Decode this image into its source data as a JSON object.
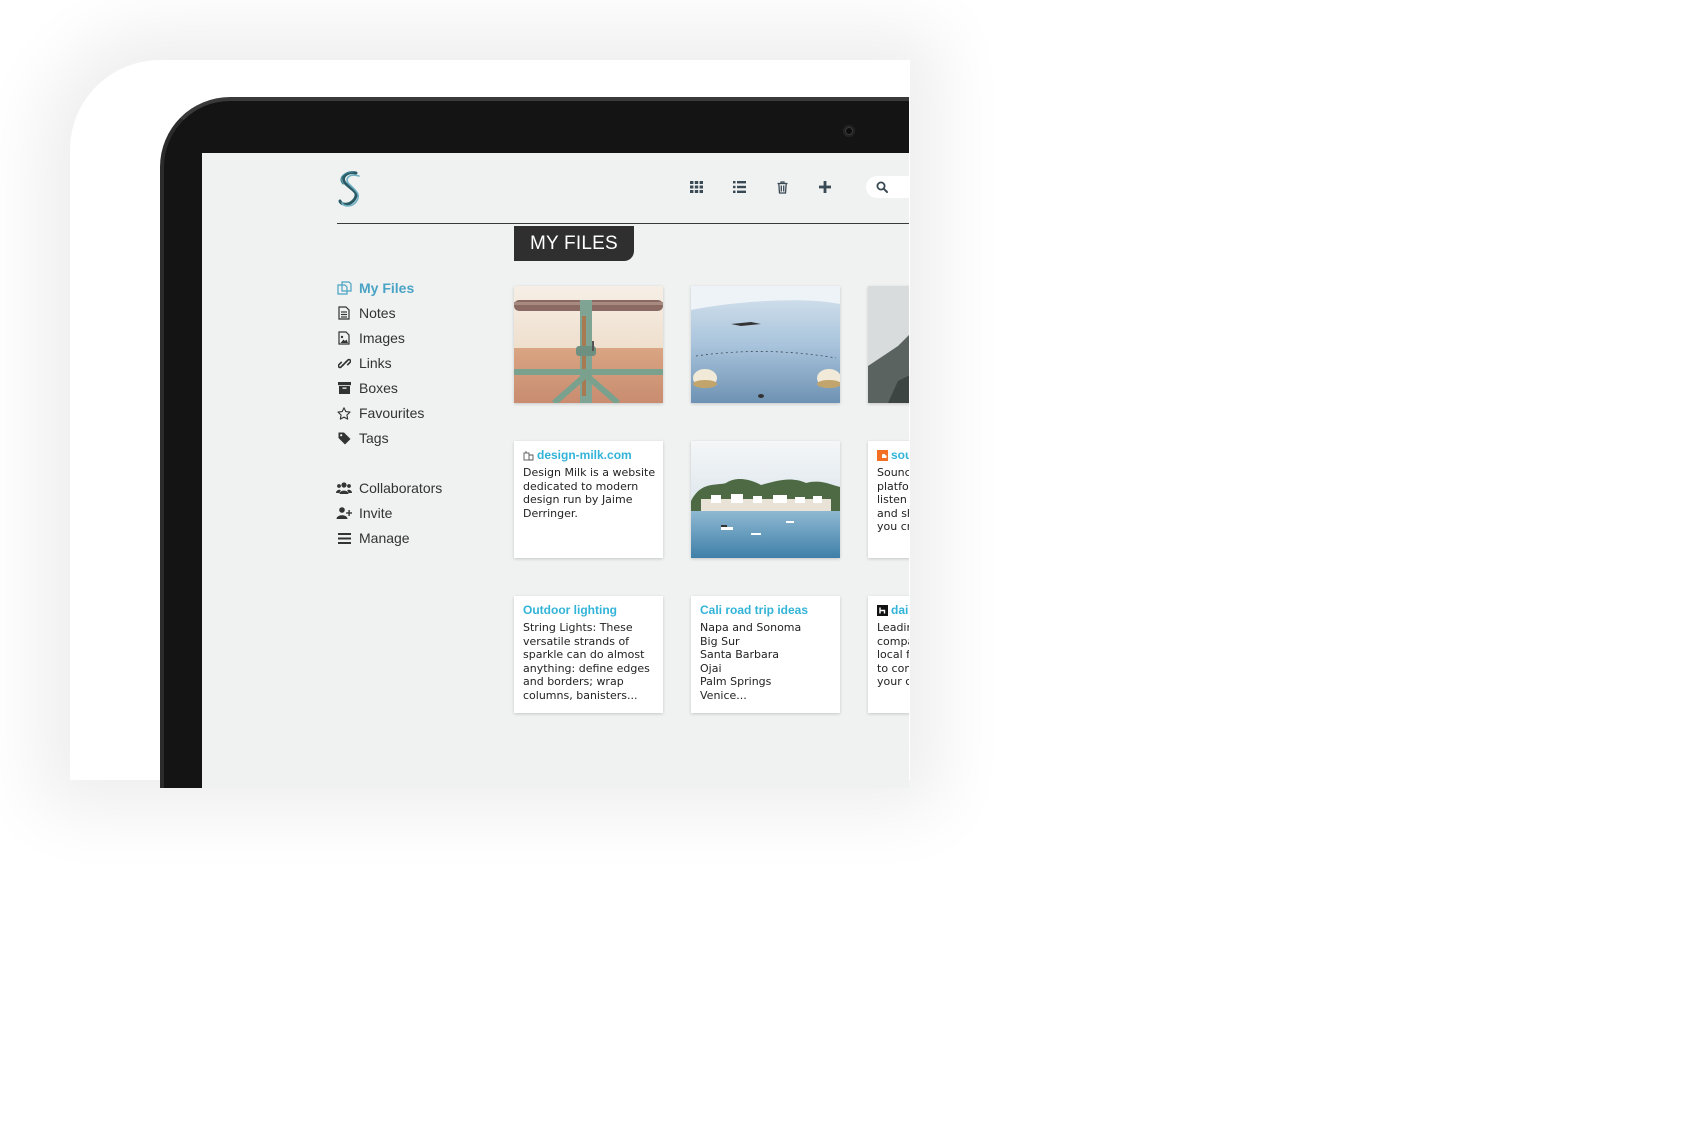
{
  "app": {
    "page_title": "MY FILES"
  },
  "toolbar": {
    "grid_view": "grid-view",
    "list_view": "list-view",
    "trash": "trash",
    "add": "add",
    "search_placeholder": ""
  },
  "sidebar": {
    "items": [
      {
        "label": "My Files",
        "icon": "files-icon",
        "active": true
      },
      {
        "label": "Notes",
        "icon": "note-icon",
        "active": false
      },
      {
        "label": "Images",
        "icon": "image-icon",
        "active": false
      },
      {
        "label": "Links",
        "icon": "link-icon",
        "active": false
      },
      {
        "label": "Boxes",
        "icon": "box-icon",
        "active": false
      },
      {
        "label": "Favourites",
        "icon": "star-icon",
        "active": false
      },
      {
        "label": "Tags",
        "icon": "tag-icon",
        "active": false
      }
    ],
    "secondary": [
      {
        "label": "Collaborators",
        "icon": "users-icon"
      },
      {
        "label": "Invite",
        "icon": "add-user-icon"
      },
      {
        "label": "Manage",
        "icon": "menu-icon"
      }
    ]
  },
  "cards": [
    {
      "type": "image",
      "subject": "rusty railing on beach"
    },
    {
      "type": "image",
      "subject": "calm lake with buoys"
    },
    {
      "type": "image",
      "subject": "rocky shore"
    },
    {
      "type": "link",
      "title": "design-milk.com",
      "text": "Design Milk is a website dedicated to modern design run by Jaime Derringer."
    },
    {
      "type": "image",
      "subject": "harbor town with boats"
    },
    {
      "type": "link",
      "title": "sou",
      "text": "Sounc\nplatfo\nlisten\nand sh\nyou cr"
    },
    {
      "type": "note",
      "title": "Outdoor lighting",
      "text": "String Lights: These versatile strands of sparkle can do almost anything: define edges and borders; wrap columns, banisters..."
    },
    {
      "type": "note",
      "title": "Cali road trip ideas",
      "text": "Napa and Sonoma\nBig Sur\nSanta Barbara\nOjai\nPalm Springs\nVenice..."
    },
    {
      "type": "link",
      "title": "dai",
      "text": "Leadir\ncompa\nlocal f\nto con\nyour c"
    }
  ],
  "colors": {
    "accent": "#4aa3c4",
    "link_title": "#32b3d8",
    "screen_bg": "#f0f2f2",
    "header_tab": "#2f2f2f"
  }
}
